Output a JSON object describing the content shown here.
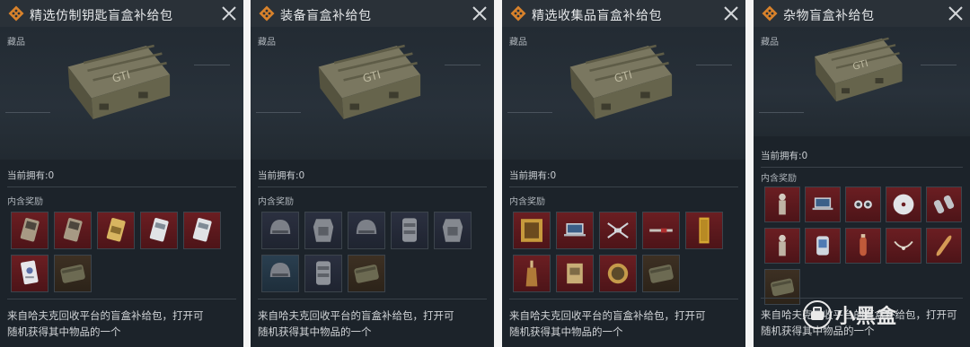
{
  "panels": [
    {
      "title": "精选仿制钥匙盲盒补给包",
      "category": "藏品",
      "owned": "当前拥有:0",
      "rewards_label": "内含奖励",
      "description_line1": "来自哈夫克回收平台的盲盒补给包，打开可",
      "description_line2": "随机获得其中物品的一个",
      "rewards": [
        {
          "icon": "key-card-icon",
          "rarity": "red"
        },
        {
          "icon": "key-card-icon",
          "rarity": "red"
        },
        {
          "icon": "key-card-gold-icon",
          "rarity": "red"
        },
        {
          "icon": "key-card-white-icon",
          "rarity": "red"
        },
        {
          "icon": "key-card-white-icon",
          "rarity": "red"
        },
        {
          "icon": "id-card-icon",
          "rarity": "red"
        },
        {
          "icon": "supply-crate-icon",
          "rarity": "brown"
        }
      ]
    },
    {
      "title": "装备盲盒补给包",
      "category": "藏品",
      "owned": "当前拥有:0",
      "rewards_label": "内含奖励",
      "description_line1": "来自哈夫克回收平台的盲盒补给包，打开可",
      "description_line2": "随机获得其中物品的一个",
      "rewards": [
        {
          "icon": "helmet-icon",
          "rarity": "navy"
        },
        {
          "icon": "body-armor-icon",
          "rarity": "navy"
        },
        {
          "icon": "helmet-icon",
          "rarity": "navy"
        },
        {
          "icon": "chest-rig-icon",
          "rarity": "navy"
        },
        {
          "icon": "body-armor-icon",
          "rarity": "navy"
        },
        {
          "icon": "helmet-icon",
          "rarity": "teal"
        },
        {
          "icon": "chest-rig-icon",
          "rarity": "navy"
        },
        {
          "icon": "supply-crate-icon",
          "rarity": "brown"
        }
      ]
    },
    {
      "title": "精选收集品盲盒补给包",
      "category": "藏品",
      "owned": "当前拥有:0",
      "rewards_label": "内含奖励",
      "description_line1": "来自哈夫克回收平台的盲盒补给包，打开可",
      "description_line2": "随机获得其中物品的一个",
      "rewards": [
        {
          "icon": "gold-frame-icon",
          "rarity": "red"
        },
        {
          "icon": "laptop-icon",
          "rarity": "red"
        },
        {
          "icon": "drone-icon",
          "rarity": "red"
        },
        {
          "icon": "syringe-icon",
          "rarity": "red"
        },
        {
          "icon": "gold-bar-icon",
          "rarity": "red"
        },
        {
          "icon": "bottle-icon",
          "rarity": "red"
        },
        {
          "icon": "circuit-board-icon",
          "rarity": "red"
        },
        {
          "icon": "compass-icon",
          "rarity": "red"
        },
        {
          "icon": "supply-crate-icon",
          "rarity": "brown"
        }
      ]
    },
    {
      "title": "杂物盲盒补给包",
      "category": "藏品",
      "owned": "当前拥有:0",
      "rewards_label": "内含奖励",
      "description_line1": "来自哈夫克回收平台的盲盒补给包，打开可",
      "description_line2": "随机获得其中物品的一个",
      "rewards": [
        {
          "icon": "figurine-icon",
          "rarity": "red"
        },
        {
          "icon": "laptop-icon",
          "rarity": "red"
        },
        {
          "icon": "goggles-icon",
          "rarity": "red"
        },
        {
          "icon": "disc-icon",
          "rarity": "red"
        },
        {
          "icon": "binoculars-icon",
          "rarity": "red"
        },
        {
          "icon": "figurine-icon",
          "rarity": "red"
        },
        {
          "icon": "watch-icon",
          "rarity": "red"
        },
        {
          "icon": "extinguisher-icon",
          "rarity": "red"
        },
        {
          "icon": "necklace-icon",
          "rarity": "red"
        },
        {
          "icon": "baguette-icon",
          "rarity": "red"
        },
        {
          "icon": "supply-crate-icon",
          "rarity": "brown"
        }
      ]
    }
  ],
  "watermark": "小黑盒",
  "colors": {
    "panel_bg": "#1c232a",
    "header_bg": "#2a3138",
    "accent": "#d9822b",
    "rarity_red": "#6b1e22",
    "rarity_navy": "#2b3040",
    "rarity_teal": "#2a3f50"
  }
}
